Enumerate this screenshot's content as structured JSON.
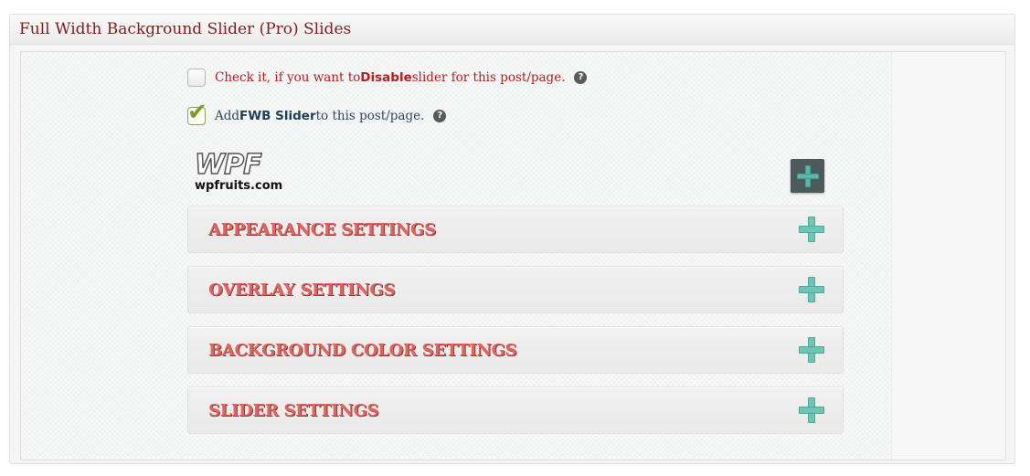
{
  "metabox": {
    "title": "Full Width Background Slider (Pro) Slides"
  },
  "options": {
    "disable": {
      "prefix": "Check it, if you want to ",
      "bold": "Disable",
      "suffix": " slider for this post/page.",
      "checked": false,
      "help": "?"
    },
    "add": {
      "prefix": "Add ",
      "bold": "FWB Slider",
      "suffix": " to this post/page.",
      "checked": true,
      "help": "?"
    }
  },
  "logo": {
    "mark": "WPF",
    "text": "wpfruits.com"
  },
  "sections": [
    {
      "title": "APPEARANCE SETTINGS"
    },
    {
      "title": "OVERLAY SETTINGS"
    },
    {
      "title": "BACKGROUND COLOR SETTINGS"
    },
    {
      "title": "SLIDER SETTINGS"
    }
  ],
  "colors": {
    "header_text": "#7a1f1f",
    "section_title": "#e06560",
    "accent_plus": "#5ab8a8",
    "add_button_bg": "#4d5a5c"
  },
  "icons": {
    "expand": "plus-icon",
    "help": "help-icon",
    "check": "checkmark-icon"
  }
}
